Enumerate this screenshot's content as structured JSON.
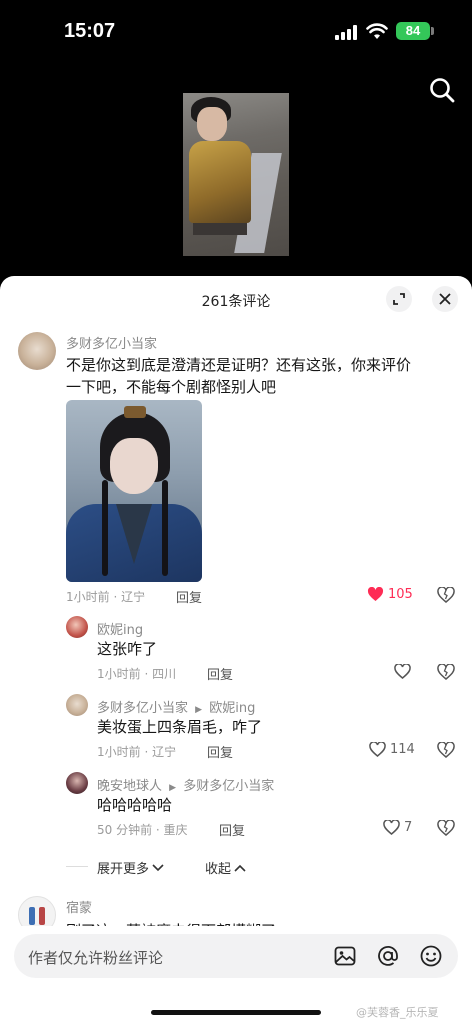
{
  "status": {
    "time": "15:07",
    "battery": "84"
  },
  "sheet": {
    "title": "261条评论"
  },
  "comments": [
    {
      "user": "多财多亿小当家",
      "text_line1": "不是你这到底是澄清还是证明？还有这张，你来评价",
      "text_line2": "一下吧，不能每个剧都怪别人吧",
      "meta": "1小时前 · 辽宁",
      "reply_label": "回复",
      "likes": "105",
      "liked": true
    }
  ],
  "replies": [
    {
      "user": "欧妮ing",
      "reply_to": "",
      "text": "这张咋了",
      "meta": "1小时前 · 四川",
      "reply_label": "回复",
      "likes": ""
    },
    {
      "user": "多财多亿小当家",
      "reply_to": "欧妮ing",
      "text": "美妆蛋上四条眉毛，咋了",
      "meta": "1小时前 · 辽宁",
      "reply_label": "回复",
      "likes": "114"
    },
    {
      "user": "晚安地球人",
      "reply_to": "多财多亿小当家",
      "text": "哈哈哈哈哈",
      "meta": "50 分钟前 · 重庆",
      "reply_label": "回复",
      "likes": "7"
    }
  ],
  "thread_controls": {
    "expand": "展开更多",
    "collapse": "收起"
  },
  "next_comment": {
    "user": "宿蒙",
    "text": "刚了这，莫被摩虫得面部模糊了"
  },
  "input": {
    "placeholder": "作者仅允许粉丝评论"
  },
  "watermark": "@芙蓉香_乐乐夏",
  "colors": {
    "like_active": "#fe2c55",
    "sheet_bg": "#ffffff",
    "battery": "#34c759"
  }
}
